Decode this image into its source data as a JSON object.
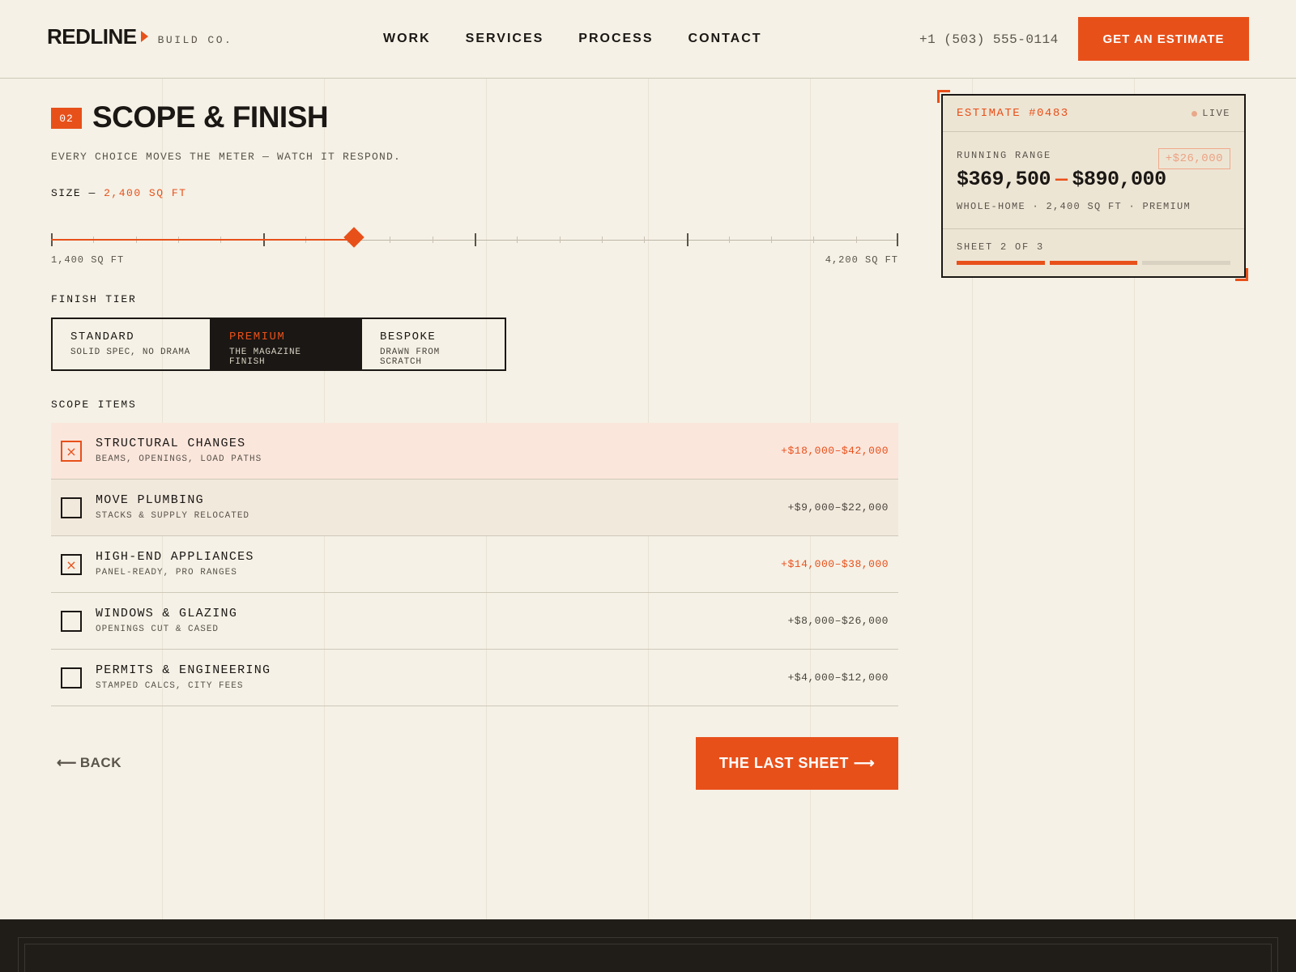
{
  "brand": {
    "name": "REDLINE",
    "sub": "BUILD CO."
  },
  "nav": [
    "WORK",
    "SERVICES",
    "PROCESS",
    "CONTACT"
  ],
  "phone": "+1 (503) 555-0114",
  "header_cta": "GET AN ESTIMATE",
  "step": {
    "number": "02",
    "title": "SCOPE & FINISH",
    "subtitle": "EVERY CHOICE MOVES THE METER — WATCH IT RESPOND."
  },
  "size": {
    "label": "SIZE —",
    "value_text": "2,400 SQ FT",
    "min_label": "1,400 SQ FT",
    "max_label": "4,200 SQ FT",
    "min": 1400,
    "max": 4200,
    "value": 2400
  },
  "finish": {
    "label": "FINISH TIER",
    "tiers": [
      {
        "name": "STANDARD",
        "desc": "SOLID SPEC, NO DRAMA",
        "active": false
      },
      {
        "name": "PREMIUM",
        "desc": "THE MAGAZINE FINISH",
        "active": true
      },
      {
        "name": "BESPOKE",
        "desc": "DRAWN FROM SCRATCH",
        "active": false
      }
    ]
  },
  "scope": {
    "label": "SCOPE ITEMS",
    "items": [
      {
        "name": "STRUCTURAL CHANGES",
        "desc": "BEAMS, OPENINGS, LOAD PATHS",
        "price": "+$18,000–$42,000",
        "checked": true
      },
      {
        "name": "MOVE PLUMBING",
        "desc": "STACKS & SUPPLY RELOCATED",
        "price": "+$9,000–$22,000",
        "checked": false
      },
      {
        "name": "HIGH-END APPLIANCES",
        "desc": "PANEL-READY, PRO RANGES",
        "price": "+$14,000–$38,000",
        "checked": true
      },
      {
        "name": "WINDOWS & GLAZING",
        "desc": "OPENINGS CUT & CASED",
        "price": "+$8,000–$26,000",
        "checked": false
      },
      {
        "name": "PERMITS & ENGINEERING",
        "desc": "STAMPED CALCS, CITY FEES",
        "price": "+$4,000–$12,000",
        "checked": false
      }
    ],
    "check_glyph": "×"
  },
  "nav_buttons": {
    "back": "BACK",
    "back_arrow": "⟵",
    "next": "THE LAST SHEET",
    "next_arrow": "⟶"
  },
  "estimate": {
    "id": "ESTIMATE #0483",
    "live": "LIVE",
    "range_label": "RUNNING RANGE",
    "delta": "+$26,000",
    "low": "$369,500",
    "dash": "—",
    "high": "$890,000",
    "meta": "WHOLE-HOME · 2,400 SQ FT · PREMIUM",
    "sheet_label": "SHEET 2 OF 3",
    "sheet_current": 2,
    "sheet_total": 3
  },
  "colors": {
    "accent": "#e8501a",
    "ink": "#1a1714",
    "paper": "#f5f1e6"
  }
}
